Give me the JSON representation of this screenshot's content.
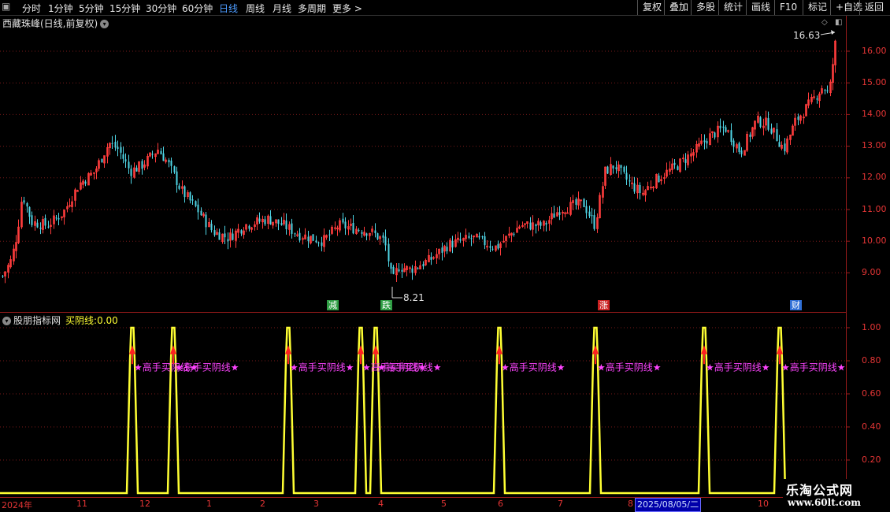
{
  "toolbar": {
    "left": [
      "分时",
      "1分钟",
      "5分钟",
      "15分钟",
      "30分钟",
      "60分钟",
      "日线",
      "周线",
      "月线",
      "多周期",
      "更多 >"
    ],
    "active": "日线",
    "right": [
      "复权",
      "叠加",
      "多股",
      "统计",
      "画线",
      "F10",
      "+自选",
      "返回"
    ]
  },
  "main": {
    "title": "西藏珠峰(日线,前复权)",
    "high_label": "16.63",
    "low_label": "8.21",
    "y_ticks": [
      "16.00",
      "15.00",
      "14.00",
      "13.00",
      "12.00",
      "11.00",
      "10.00",
      "9.00"
    ],
    "events": [
      {
        "label": "减",
        "color": "#2f9e44"
      },
      {
        "label": "跌",
        "color": "#2f9e44"
      },
      {
        "label": "涨",
        "color": "#cc2222"
      },
      {
        "label": "财",
        "color": "#2f6fd6"
      }
    ]
  },
  "sub": {
    "name": "股朋指标网",
    "value_name": "买阴线:",
    "value": "0.00",
    "y_ticks": [
      "1.00",
      "0.80",
      "0.60",
      "0.40",
      "0.20"
    ],
    "signal_text": "★高手买阴线★"
  },
  "dates": {
    "labels": [
      "2024年",
      "11",
      "12",
      "1",
      "2",
      "3",
      "4",
      "5",
      "6",
      "7",
      "8",
      "10"
    ],
    "cursor": "2025/08/05/二"
  },
  "watermark": {
    "title": "乐淘公式网",
    "url": "www.60lt.com"
  },
  "colors": {
    "up": "#ff3c3c",
    "down": "#4fd6e6",
    "signal": "#ffff33",
    "text_signal": "#ff44ff",
    "axis": "#9b1b1b"
  }
}
